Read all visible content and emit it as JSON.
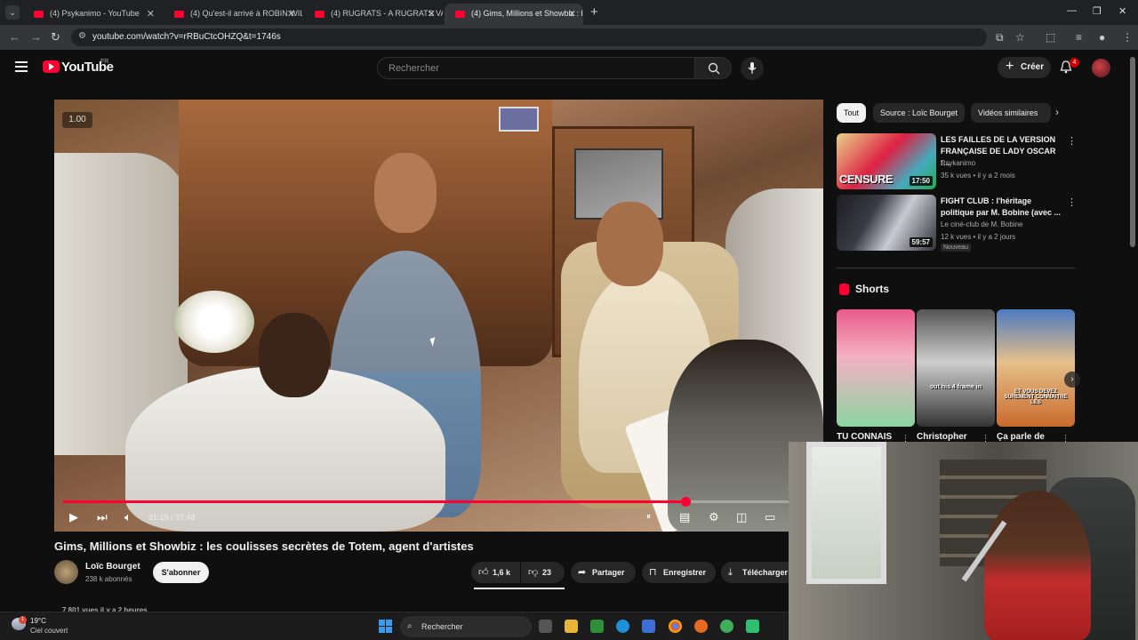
{
  "browser": {
    "tabs": [
      {
        "title": "(4) Psykanimo - YouTube"
      },
      {
        "title": "(4) Qu'est-il arrivé à ROBIN WIL"
      },
      {
        "title": "(4) RUGRATS - A RUGRATS VAC"
      },
      {
        "title": "(4) Gims, Millions et Showbiz : l"
      }
    ],
    "active_tab": 3,
    "new_tab": "+",
    "url": "youtube.com/watch?v=rRBuCtcOHZQ&t=1746s"
  },
  "youtube": {
    "wordmark": "YouTube",
    "country": "FR",
    "search_placeholder": "Rechercher",
    "create_label": "Créer",
    "notification_count": "4"
  },
  "player": {
    "speed_badge": "1.00",
    "time_display": "31:19 / 37:48",
    "progress": 0.8285,
    "colors": {
      "accent": "#ff0033"
    }
  },
  "video": {
    "title": "Gims, Millions et Showbiz : les coulisses secrètes de Totem, agent d'artistes",
    "channel": "Loïc Bourget",
    "subscribers": "238 k abonnés",
    "subscribe_label": "S'abonner",
    "likes": "1,6 k",
    "dislikes": "23",
    "share_label": "Partager",
    "save_label": "Enregistrer",
    "download_label": "Télécharger",
    "views_peek": "7 801 vues  il y a 2 heures"
  },
  "sidebar": {
    "chips": [
      "Tout",
      "Source : Loïc Bourget",
      "Vidéos similaires"
    ],
    "recommendations": [
      {
        "title": "LES FAILLES DE LA VERSION FRANÇAISE DE LADY OSCAR :...",
        "channel": "Psykanimo",
        "meta": "35 k vues • il y a 2 mois",
        "duration": "17:50",
        "thumb_text": "CENSURE"
      },
      {
        "title": "FIGHT CLUB : l'héritage politique par M. Bobine (avec ...",
        "channel": "Le ciné-club de M. Bobine",
        "meta": "12 k vues • il y a 2 jours",
        "duration": "59:57",
        "badge": "Nouveau"
      }
    ],
    "shorts_label": "Shorts",
    "shorts": [
      {
        "title": "TU CONNAIS"
      },
      {
        "title": "Christopher",
        "thumb_text": "out his 4 frame in"
      },
      {
        "title": "Ça parle de",
        "thumb_text": "ET VOUS DEVEZ SUREMENT CONNAITRE LES"
      }
    ]
  },
  "taskbar": {
    "temperature": "19°C",
    "weather": "Ciel couvert",
    "weather_badge": "1",
    "search_label": "Rechercher"
  }
}
